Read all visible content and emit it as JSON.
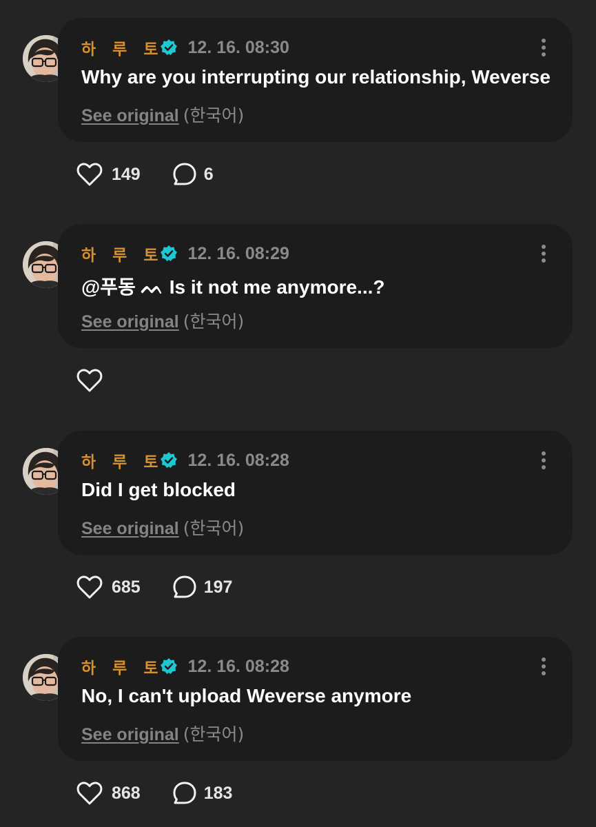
{
  "posts": [
    {
      "author": "하   루   토",
      "timestamp": "12. 16. 08:30",
      "message": "Why are you interrupting our relationship, Weverse",
      "see_original": "See original",
      "language": "(한국어)",
      "likes": "149",
      "comments": "6"
    },
    {
      "author": "하   루   토",
      "timestamp": "12. 16. 08:29",
      "message": "@푸동 ᨓ Is it not me anymore...?",
      "see_original": "See original",
      "language": "(한국어)",
      "likes": "",
      "comments": ""
    },
    {
      "author": "하   루   토",
      "timestamp": "12. 16. 08:28",
      "message": "Did I get blocked",
      "see_original": "See original",
      "language": "(한국어)",
      "likes": "685",
      "comments": "197"
    },
    {
      "author": "하   루   토",
      "timestamp": "12. 16. 08:28",
      "message": "No, I can't upload Weverse anymore",
      "see_original": "See original",
      "language": "(한국어)",
      "likes": "868",
      "comments": "183"
    }
  ],
  "icons": {
    "verified": "verified-badge-icon",
    "more": "more-vertical-icon",
    "like": "heart-outline-icon",
    "comment": "speech-bubble-icon"
  },
  "colors": {
    "background": "#242424",
    "bubble": "#1c1c1c",
    "author": "#d7902f",
    "verified": "#1ec8d2",
    "muted": "#848484",
    "text": "#ffffff"
  }
}
